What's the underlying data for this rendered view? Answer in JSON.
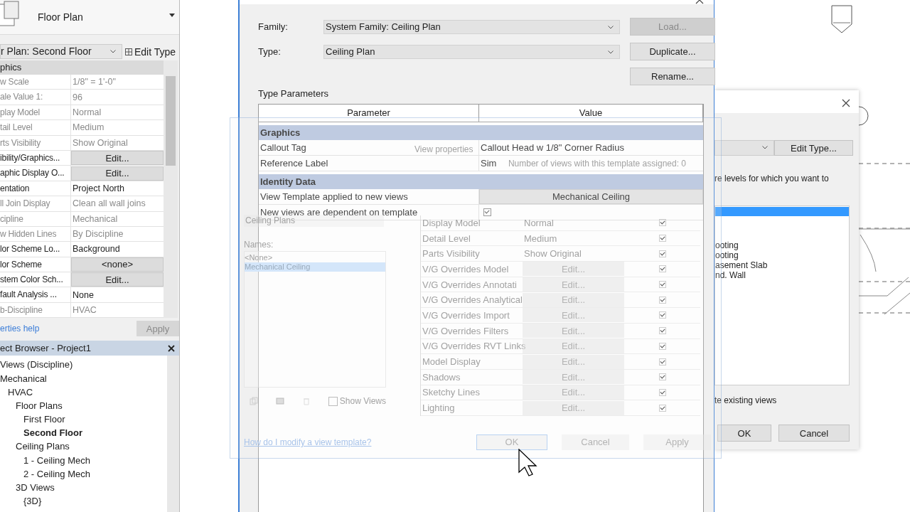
{
  "type_selector": {
    "label": "Floor Plan"
  },
  "properties": {
    "instance": "r Plan: Second Floor",
    "edit_type": "Edit Type",
    "group": "phics",
    "rows": [
      {
        "name": "w Scale",
        "kind": "text",
        "value": "1/8\" = 1'-0\"",
        "disabled": true
      },
      {
        "name": "ale Value    1:",
        "kind": "text",
        "value": "96",
        "disabled": true
      },
      {
        "name": "play Model",
        "kind": "text",
        "value": "Normal",
        "disabled": true
      },
      {
        "name": "tail Level",
        "kind": "text",
        "value": "Medium",
        "disabled": true
      },
      {
        "name": "rts Visibility",
        "kind": "text",
        "value": "Show Original",
        "disabled": true
      },
      {
        "name": "ibility/Graphics...",
        "kind": "button",
        "value": "Edit...",
        "disabled": false
      },
      {
        "name": "aphic Display O...",
        "kind": "button",
        "value": "Edit...",
        "disabled": false
      },
      {
        "name": "entation",
        "kind": "text",
        "value": "Project North",
        "disabled": false
      },
      {
        "name": "ll Join Display",
        "kind": "text",
        "value": "Clean all wall joins",
        "disabled": true
      },
      {
        "name": "cipline",
        "kind": "text",
        "value": "Mechanical",
        "disabled": true
      },
      {
        "name": "w Hidden Lines",
        "kind": "text",
        "value": "By Discipline",
        "disabled": true
      },
      {
        "name": "lor Scheme Lo...",
        "kind": "text",
        "value": "Background",
        "disabled": false
      },
      {
        "name": "lor Scheme",
        "kind": "button",
        "value": "<none>",
        "disabled": false
      },
      {
        "name": "stem Color Sch...",
        "kind": "button",
        "value": "Edit...",
        "disabled": false
      },
      {
        "name": "fault Analysis ...",
        "kind": "text",
        "value": "None",
        "disabled": false
      },
      {
        "name": "b-Discipline",
        "kind": "text",
        "value": "HVAC",
        "disabled": true
      }
    ],
    "help_link": "erties help",
    "apply": {
      "label": "Apply",
      "disabled": true
    }
  },
  "project_browser": {
    "title": "ect Browser - Project1",
    "tree": [
      {
        "label": "Views (Discipline)",
        "selected": false,
        "children": [
          {
            "label": "Mechanical",
            "selected": false,
            "children": [
              {
                "label": "HVAC",
                "selected": false,
                "children": [
                  {
                    "label": "Floor Plans",
                    "selected": false,
                    "children": [
                      {
                        "label": "First Floor",
                        "selected": false
                      },
                      {
                        "label": "Second Floor",
                        "selected": true
                      }
                    ]
                  },
                  {
                    "label": "Ceiling Plans",
                    "selected": false,
                    "children": [
                      {
                        "label": "1 - Ceiling Mech",
                        "selected": false
                      },
                      {
                        "label": "2 - Ceiling Mech",
                        "selected": false
                      }
                    ]
                  },
                  {
                    "label": "3D Views",
                    "selected": false,
                    "children": [
                      {
                        "label": "{3D}",
                        "selected": false
                      }
                    ]
                  }
                ]
              }
            ]
          }
        ]
      }
    ]
  },
  "type_properties": {
    "family_label": "Family:",
    "family": "System Family: Ceiling Plan",
    "type_label": "Type:",
    "type": "Ceiling Plan",
    "buttons": [
      {
        "label": "Load...",
        "disabled": true
      },
      {
        "label": "Duplicate...",
        "disabled": false
      },
      {
        "label": "Rename...",
        "disabled": false
      }
    ],
    "section": "Type Parameters",
    "columns": [
      "Parameter",
      "Value"
    ],
    "groups": [
      {
        "name": "Graphics",
        "rows": [
          {
            "name": "Callout Tag",
            "kind": "text",
            "value": "Callout Head w 1/8\" Corner Radius"
          },
          {
            "name": "Reference Label",
            "kind": "text",
            "value": "Sim"
          }
        ]
      },
      {
        "name": "Identity Data",
        "rows": [
          {
            "name": "View Template applied to new views",
            "kind": "button",
            "value": "Mechanical Ceiling"
          },
          {
            "name": "New views are dependent on template",
            "kind": "checkbox",
            "checked": true
          }
        ]
      }
    ]
  },
  "view_template_dialog": {
    "view_properties": "View properties",
    "assigned": "Number of views with this template assigned:  0",
    "view_type_filter": "Ceiling Plans",
    "names_label": "Names:",
    "names": [
      {
        "label": "<None>",
        "selected": false
      },
      {
        "label": "Mechanical Ceiling",
        "selected": true
      }
    ],
    "show_views": {
      "label": "Show Views",
      "checked": false
    },
    "rows": [
      {
        "name": "Display Model",
        "kind": "text",
        "value": "Normal",
        "include": true
      },
      {
        "name": "Detail Level",
        "kind": "text",
        "value": "Medium",
        "include": true
      },
      {
        "name": "Parts Visibility",
        "kind": "text",
        "value": "Show Original",
        "include": true
      },
      {
        "name": "V/G Overrides Model",
        "kind": "button",
        "value": "Edit...",
        "include": true
      },
      {
        "name": "V/G Overrides Annotati",
        "kind": "button",
        "value": "Edit...",
        "include": true
      },
      {
        "name": "V/G Overrides Analytical",
        "kind": "button",
        "value": "Edit...",
        "include": true
      },
      {
        "name": "V/G Overrides Import",
        "kind": "button",
        "value": "Edit...",
        "include": true
      },
      {
        "name": "V/G Overrides Filters",
        "kind": "button",
        "value": "Edit...",
        "include": true
      },
      {
        "name": "V/G Overrides RVT Links",
        "kind": "button",
        "value": "Edit...",
        "include": true
      },
      {
        "name": "Model Display",
        "kind": "button",
        "value": "Edit...",
        "include": true
      },
      {
        "name": "Shadows",
        "kind": "button",
        "value": "Edit...",
        "include": true
      },
      {
        "name": "Sketchy Lines",
        "kind": "button",
        "value": "Edit...",
        "include": true
      },
      {
        "name": "Lighting",
        "kind": "button",
        "value": "Edit...",
        "include": true
      }
    ],
    "help_link": "How do I modify a view template?",
    "buttons": [
      "OK",
      "Cancel",
      "Apply"
    ]
  },
  "levels_dialog": {
    "edit_type": "Edit Type...",
    "instruction": "re levels for which you want to",
    "levels": [
      "ooting",
      "ooting",
      "asement Slab",
      "nd. Wall"
    ],
    "option": "te existing views",
    "buttons": [
      "OK",
      "Cancel"
    ]
  }
}
